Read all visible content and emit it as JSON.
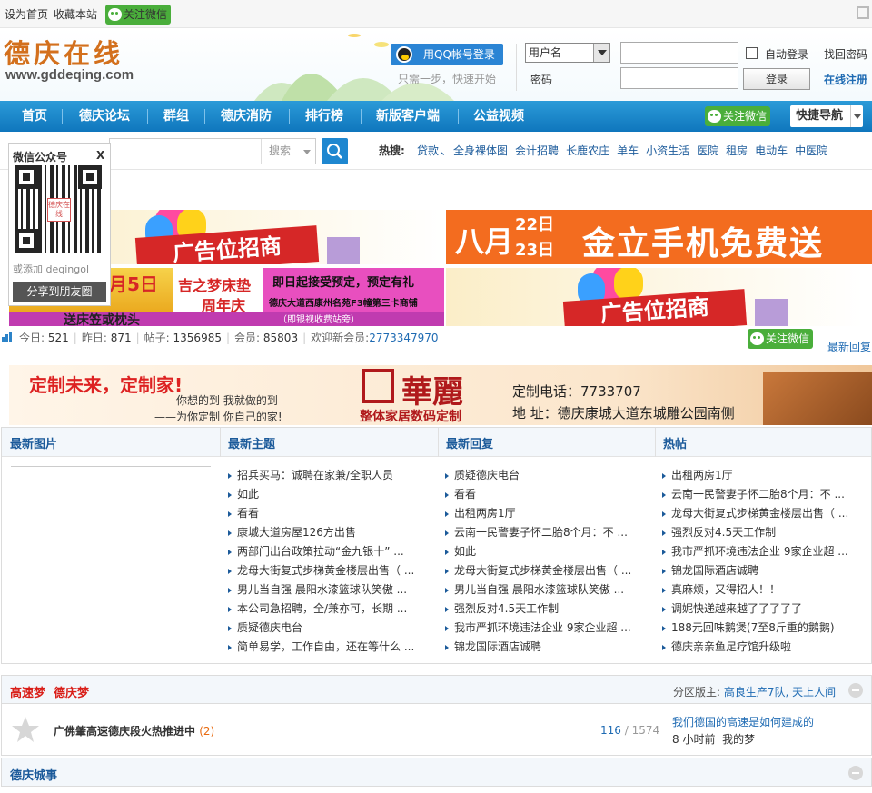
{
  "topbar": {
    "set_home": "设为首页",
    "bookmark": "收藏本站",
    "wechat_follow": "关注微信"
  },
  "logo": {
    "name": "德庆在线",
    "url": "www.gddeqing.com"
  },
  "login": {
    "qq_button": "用QQ帐号登录",
    "qq_hint": "只需一步，快速开始",
    "username_select": "用户名",
    "password_label": "密码",
    "auto_login": "自动登录",
    "login_button": "登录",
    "find_password": "找回密码",
    "register": "在线注册"
  },
  "nav": {
    "items": [
      "首页",
      "德庆论坛",
      "群组",
      "德庆消防",
      "排行榜",
      "新版客户端",
      "公益视频"
    ],
    "wechat_follow": "关注微信",
    "quick_nav": "快捷导航"
  },
  "search": {
    "type": "搜索",
    "hot_label": "热搜:",
    "hot_items": [
      "贷款",
      "全身裸体图",
      "会计招聘",
      "长鹿农庄",
      "单车",
      "小资生活",
      "医院",
      "租房",
      "电动车",
      "中医院"
    ]
  },
  "popup": {
    "title": "微信公众号",
    "close": "X",
    "qr_center": "德庆在线",
    "add_text": "或添加 deqingol",
    "share_button": "分享到朋友圈"
  },
  "ads": {
    "recruit": "广告位招商",
    "recruit2": "广告位招商",
    "phone_promo": "八月",
    "phone_day1": "22日",
    "phone_day2": "23日",
    "phone_text": "金立手机免费送",
    "mattress_date": "月5日",
    "mattress_brand": "吉之梦床垫",
    "mattress_anniv": "周年庆",
    "mattress_pre": "即日起接受预定，预定有礼",
    "mattress_addr": "德庆大道西康州名苑F3幢第三卡商铺",
    "mattress_addr2": "（即银视收费站旁）",
    "mattress_gift": "送床笠或枕头"
  },
  "stats": {
    "today_label": "今日:",
    "today": "521",
    "yesterday_label": "昨日:",
    "yesterday": "871",
    "posts_label": "帖子:",
    "posts": "1356985",
    "members_label": "会员:",
    "members": "85803",
    "welcome": "欢迎新会员:",
    "new_member": "2773347970",
    "wechat": "关注微信",
    "latest_reply": "最新回复"
  },
  "banner": {
    "slogan1": "定制未来，定制家!",
    "slogan2": "——你想的到 我就做的到",
    "slogan3": "——为你定制 你自己的家!",
    "brand": "華麗",
    "brand_sub": "整体家居数码定制",
    "phone": "定制电话：7733707",
    "addr": "地 址：德庆康城大道东城雕公园南侧"
  },
  "columns": {
    "headers": [
      "最新图片",
      "最新主题",
      "最新回复",
      "热帖"
    ],
    "topics": [
      "招兵买马：诚聘在家兼/全职人员",
      "如此",
      "看看",
      "康城大道房屋126方出售",
      "两部门出台政策拉动“金九银十” ...",
      "龙母大街复式步梯黄金楼层出售（ ...",
      "男儿当自强  晨阳水漆篮球队笑傲 ...",
      "本公司急招聘，全/兼亦可，长期 ...",
      "质疑德庆电台",
      "简单易学，工作自由，还在等什么 ..."
    ],
    "replies": [
      "质疑德庆电台",
      "看看",
      "出租两房1厅",
      "云南一民警妻子怀二胎8个月：不 ...",
      "如此",
      "龙母大街复式步梯黄金楼层出售（ ...",
      "男儿当自强  晨阳水漆篮球队笑傲 ...",
      "强烈反对4.5天工作制",
      "我市严抓环境违法企业  9家企业超 ...",
      "锦龙国际酒店诚聘"
    ],
    "hot": [
      "出租两房1厅",
      "云南一民警妻子怀二胎8个月：不 ...",
      "龙母大街复式步梯黄金楼层出售（ ...",
      "强烈反对4.5天工作制",
      "我市严抓环境违法企业  9家企业超 ...",
      "锦龙国际酒店诚聘",
      "真麻烦，又得招人！！",
      "调妮快递越来越了了了了了",
      "188元回味鹅煲(7至8斤重的鹅鹅)",
      "德庆亲亲鱼足疗馆升级啦"
    ]
  },
  "forum1": {
    "title": "高速梦  德庆梦",
    "moderator_label": "分区版主:",
    "moderators": "高良生产7队, 天上人间",
    "thread_title": "广佛肇高速德庆段火热推进中",
    "thread_count": "(2)",
    "today": "116",
    "total": "/ 1574",
    "last_title": "我们德国的高速是如何建成的",
    "last_time": "8 小时前  我的梦"
  },
  "forum2": {
    "title": "德庆城事"
  }
}
